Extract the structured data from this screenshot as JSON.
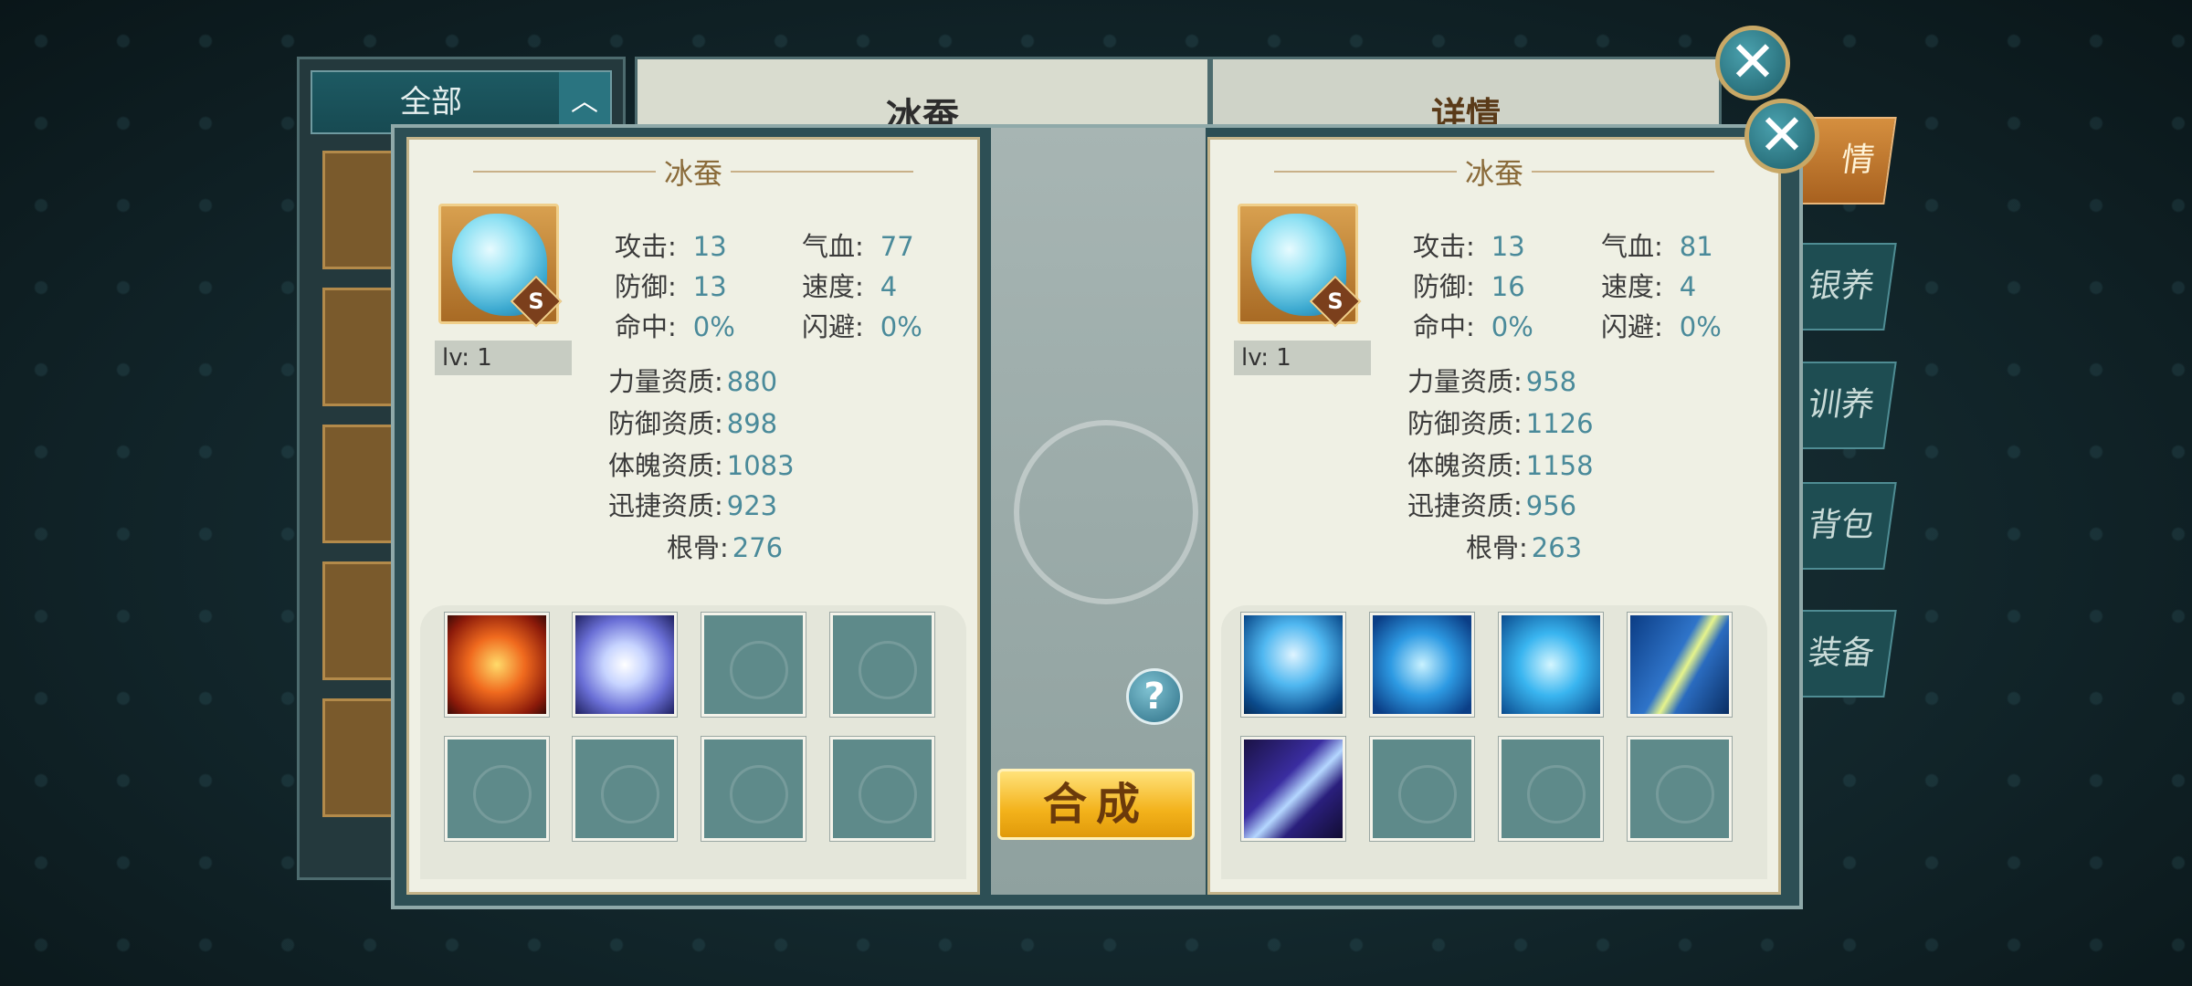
{
  "background": {
    "category_label": "全部",
    "pet_name_title": "冰蚕",
    "detail_title": "详情",
    "side_tabs": [
      "情",
      "银养",
      "训养",
      "背包",
      "装备"
    ]
  },
  "left_pet": {
    "name": "冰蚕",
    "rank": "S",
    "level": "lv: 1",
    "stats": {
      "attack_label": "攻击:",
      "attack": "13",
      "hp_label": "气血:",
      "hp": "77",
      "defense_label": "防御:",
      "defense": "13",
      "speed_label": "速度:",
      "speed": "4",
      "hit_label": "命中:",
      "hit": "0%",
      "dodge_label": "闪避:",
      "dodge": "0%"
    },
    "aptitudes": {
      "power_label": "力量资质:",
      "power": "880",
      "def_label": "防御资质:",
      "def": "898",
      "body_label": "体魄资质:",
      "body": "1083",
      "agility_label": "迅捷资质:",
      "agility": "923",
      "bone_label": "根骨:",
      "bone": "276"
    },
    "skills": [
      "fire-skill",
      "whirlwind-skill",
      "empty",
      "empty",
      "empty",
      "empty",
      "empty",
      "empty"
    ]
  },
  "right_pet": {
    "name": "冰蚕",
    "rank": "S",
    "level": "lv: 1",
    "stats": {
      "attack_label": "攻击:",
      "attack": "13",
      "hp_label": "气血:",
      "hp": "81",
      "defense_label": "防御:",
      "defense": "16",
      "speed_label": "速度:",
      "speed": "4",
      "hit_label": "命中:",
      "hit": "0%",
      "dodge_label": "闪避:",
      "dodge": "0%"
    },
    "aptitudes": {
      "power_label": "力量资质:",
      "power": "958",
      "def_label": "防御资质:",
      "def": "1126",
      "body_label": "体魄资质:",
      "body": "1158",
      "agility_label": "迅捷资质:",
      "agility": "956",
      "bone_label": "根骨:",
      "bone": "263"
    },
    "skills": [
      "lightning-skill",
      "vortex-skill",
      "cross-blade-skill",
      "shield-skill",
      "claw-skill",
      "empty",
      "empty",
      "empty"
    ]
  },
  "actions": {
    "merge_label": "合成",
    "help_label": "?",
    "close_label": "✕"
  }
}
